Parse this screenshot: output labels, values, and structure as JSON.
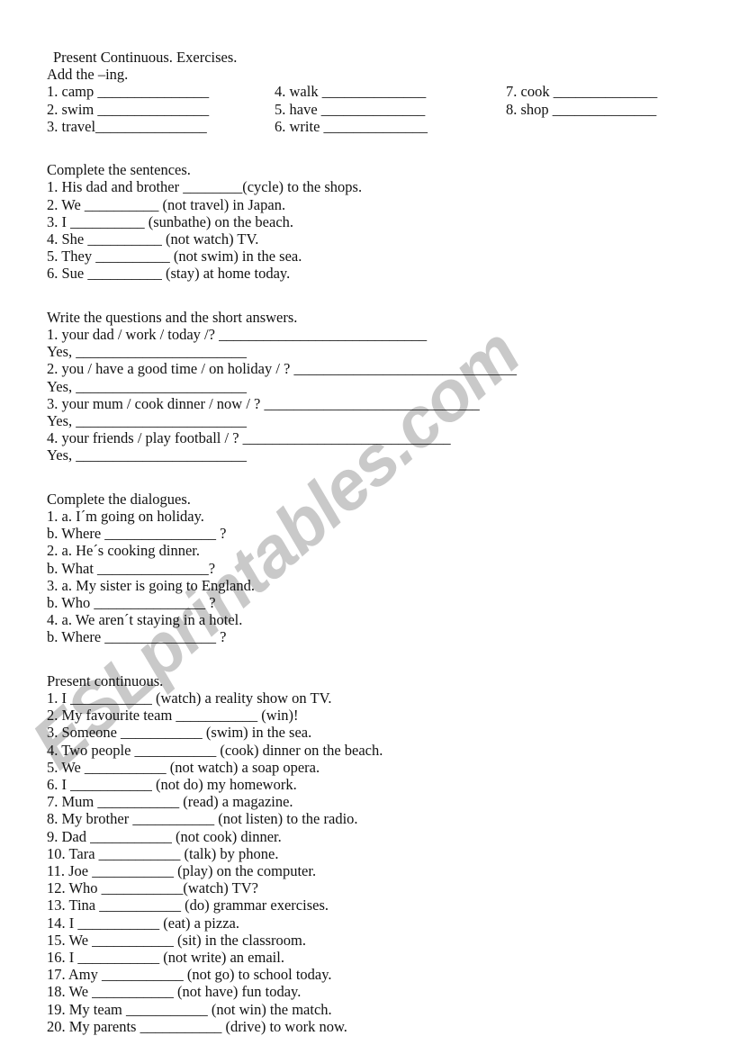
{
  "watermark": {
    "text": "ESLprintables.com",
    "color": "#c9c9c9"
  },
  "title": "Present Continuous. Exercises.",
  "section1": {
    "heading": "Add the –ing.",
    "items": [
      {
        "col1": "1. camp _______________",
        "col2": "4. walk ______________",
        "col3": "7. cook ______________"
      },
      {
        "col1": "2. swim _______________",
        "col2": "5. have ______________",
        "col3": "8. shop ______________"
      },
      {
        "col1": "3. travel_______________",
        "col2": "6. write ______________",
        "col3": ""
      }
    ]
  },
  "section2": {
    "heading": "Complete the sentences.",
    "items": [
      "1. His dad and brother ________(cycle) to the shops.",
      "2. We __________ (not travel) in Japan.",
      "3. I __________ (sunbathe) on the beach.",
      "4. She __________ (not watch) TV.",
      "5. They __________ (not swim) in the sea.",
      "6. Sue __________ (stay) at home today."
    ]
  },
  "section3": {
    "heading": "Write the questions and the short answers.",
    "items": [
      "1. your dad / work / today /? ____________________________",
      "Yes, _______________________",
      "2. you / have a good time / on holiday / ? ______________________________",
      "Yes, _______________________",
      "3. your mum / cook dinner / now / ? _____________________________",
      "Yes, _______________________",
      "4. your friends / play football / ? ____________________________",
      "Yes, _______________________"
    ]
  },
  "section4": {
    "heading": "Complete the dialogues.",
    "items": [
      "1. a. I´m going on holiday.",
      "b. Where _______________ ?",
      "2. a. He´s cooking dinner.",
      "b. What _______________?",
      "3. a. My sister is going to England.",
      "b. Who _______________ ?",
      "4. a. We aren´t staying in a hotel.",
      "b. Where _______________ ?"
    ]
  },
  "section5": {
    "heading": "Present continuous.",
    "items": [
      "1. I ___________ (watch) a reality show on TV.",
      "2. My favourite team ___________ (win)!",
      "3. Someone ___________ (swim) in the sea.",
      "4. Two people ___________ (cook) dinner on the beach.",
      "5. We ___________ (not watch) a soap opera.",
      "6. I ___________ (not do) my homework.",
      "7. Mum ___________ (read) a magazine.",
      "8. My brother ___________ (not listen) to the radio.",
      "9. Dad ___________ (not cook) dinner.",
      "10. Tara ___________ (talk) by phone.",
      "11. Joe ___________ (play) on the computer.",
      "12. Who ___________(watch) TV?",
      "13. Tina ___________ (do) grammar exercises.",
      "14. I ___________ (eat) a pizza.",
      "15. We ___________ (sit) in the classroom.",
      "16. I ___________ (not write) an email.",
      "17. Amy ___________ (not go) to school today.",
      "18. We ___________ (not have) fun today.",
      "19. My team ___________ (not win) the match.",
      "20. My parents ___________ (drive) to work now."
    ]
  }
}
